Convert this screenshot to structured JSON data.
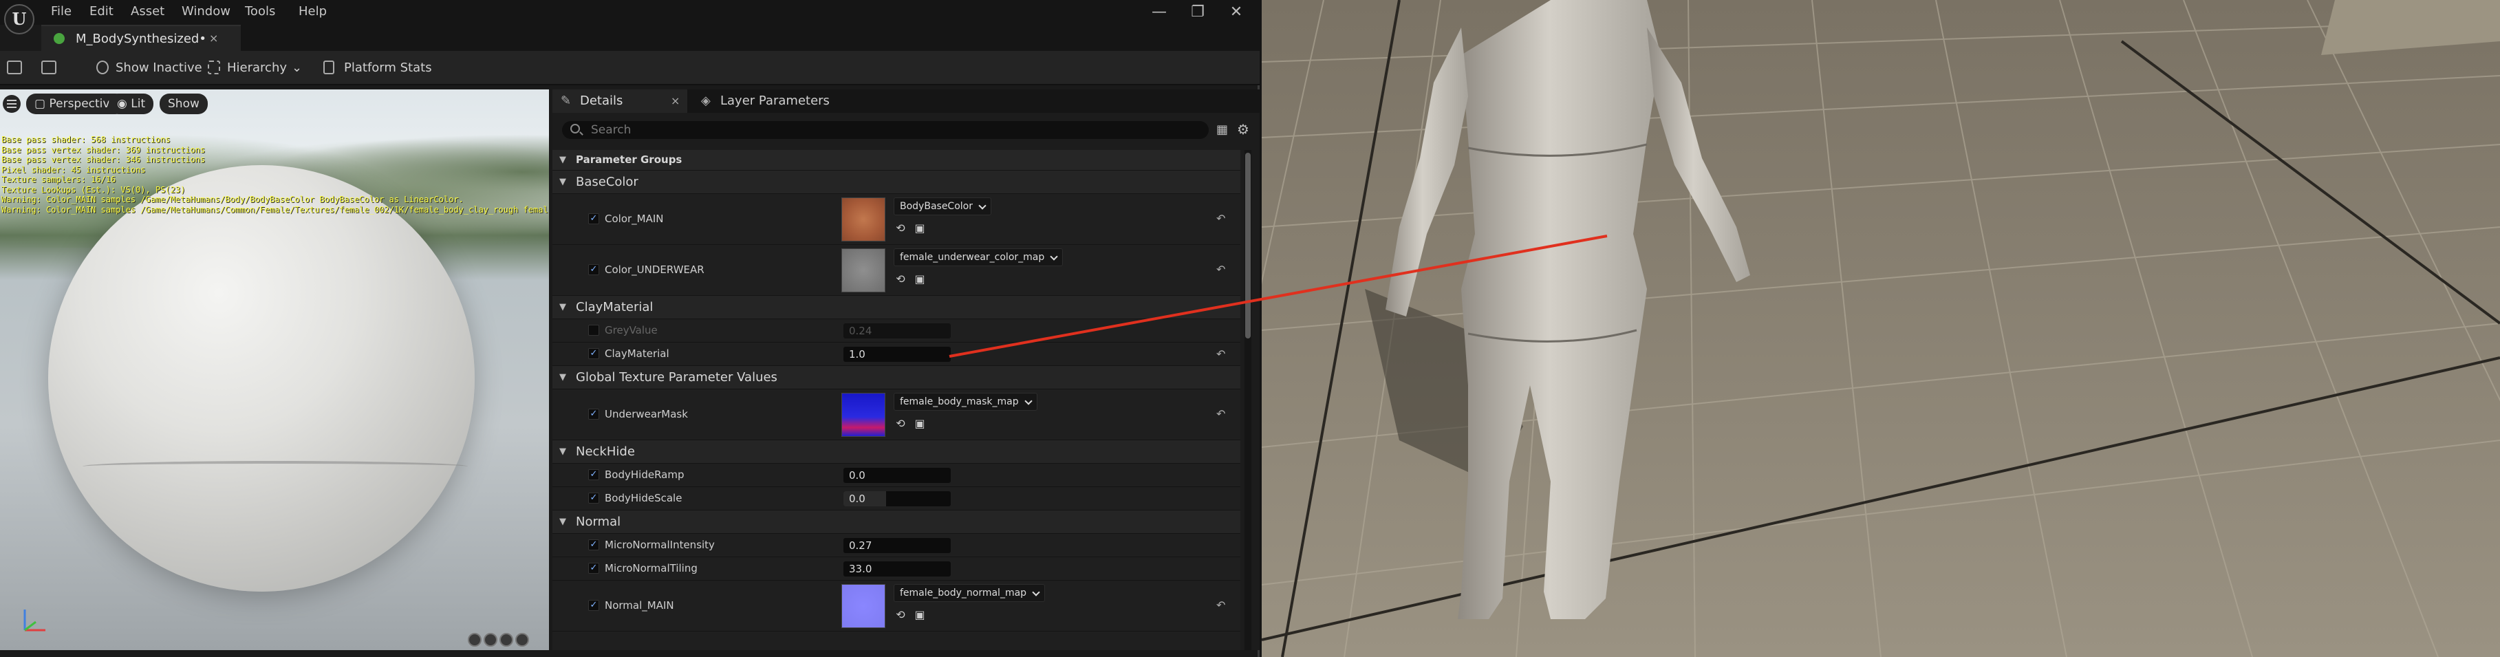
{
  "menu": [
    "File",
    "Edit",
    "Asset",
    "Window",
    "Tools",
    "Help"
  ],
  "asset_tab": {
    "title": "M_BodySynthesized•",
    "close": "×"
  },
  "window_controls": {
    "minimize": "—",
    "maximize": "❐",
    "close": "✕"
  },
  "toolbar": {
    "show_inactive": "Show Inactive",
    "hierarchy": "Hierarchy",
    "platform_stats": "Platform Stats"
  },
  "viewport": {
    "perspective": "Perspective",
    "lit": "Lit",
    "show": "Show",
    "overlay_lines": [
      "Base pass shader: 568 instructions",
      "Base pass vertex shader: 369 instructions",
      "Base pass vertex shader: 346 instructions",
      "Pixel shader: 45 instructions",
      "Texture samplers: 16/16",
      "Texture Lookups (Est.): VS(0), PS(23)",
      "Warning: Color_MAIN samples /Game/MetaHumans/Body/BodyBaseColor BodyBaseColor as LinearColor.",
      "Warning: Color_MAIN samples /Game/MetaHumans/Common/Female/Textures/female_002/1K/female_body_clay_rough female_body_clay_rough as Color."
    ]
  },
  "details": {
    "tab_details": "Details",
    "tab_close": "×",
    "tab_layer": "Layer Parameters",
    "search_placeholder": "Search",
    "groups_header": "Parameter Groups",
    "base_color": {
      "group": "BaseColor",
      "color_main": {
        "label": "Color_MAIN",
        "texture": "BodyBaseColor"
      },
      "color_underwear": {
        "label": "Color_UNDERWEAR",
        "texture": "female_underwear_color_map"
      }
    },
    "clay": {
      "group": "ClayMaterial",
      "grey_value": {
        "label": "GreyValue",
        "value": "0.24"
      },
      "clay_material": {
        "label": "ClayMaterial",
        "value": "1.0"
      }
    },
    "global_tex": {
      "group": "Global Texture Parameter Values",
      "underwear_mask": {
        "label": "UnderwearMask",
        "texture": "female_body_mask_map"
      }
    },
    "neck_hide": {
      "group": "NeckHide",
      "ramp": {
        "label": "BodyHideRamp",
        "value": "0.0"
      },
      "scale": {
        "label": "BodyHideScale",
        "value": "0.0",
        "fill": 0.4
      }
    },
    "normal": {
      "group": "Normal",
      "micro_intensity": {
        "label": "MicroNormalIntensity",
        "value": "0.27"
      },
      "micro_tiling": {
        "label": "MicroNormalTiling",
        "value": "33.0"
      },
      "normal_main": {
        "label": "Normal_MAIN",
        "texture": "female_body_normal_map"
      }
    }
  },
  "colors": {
    "accent_green": "#49a43f",
    "annotation_red": "#e0301e",
    "checkbox_blue": "#7fb2ff"
  }
}
